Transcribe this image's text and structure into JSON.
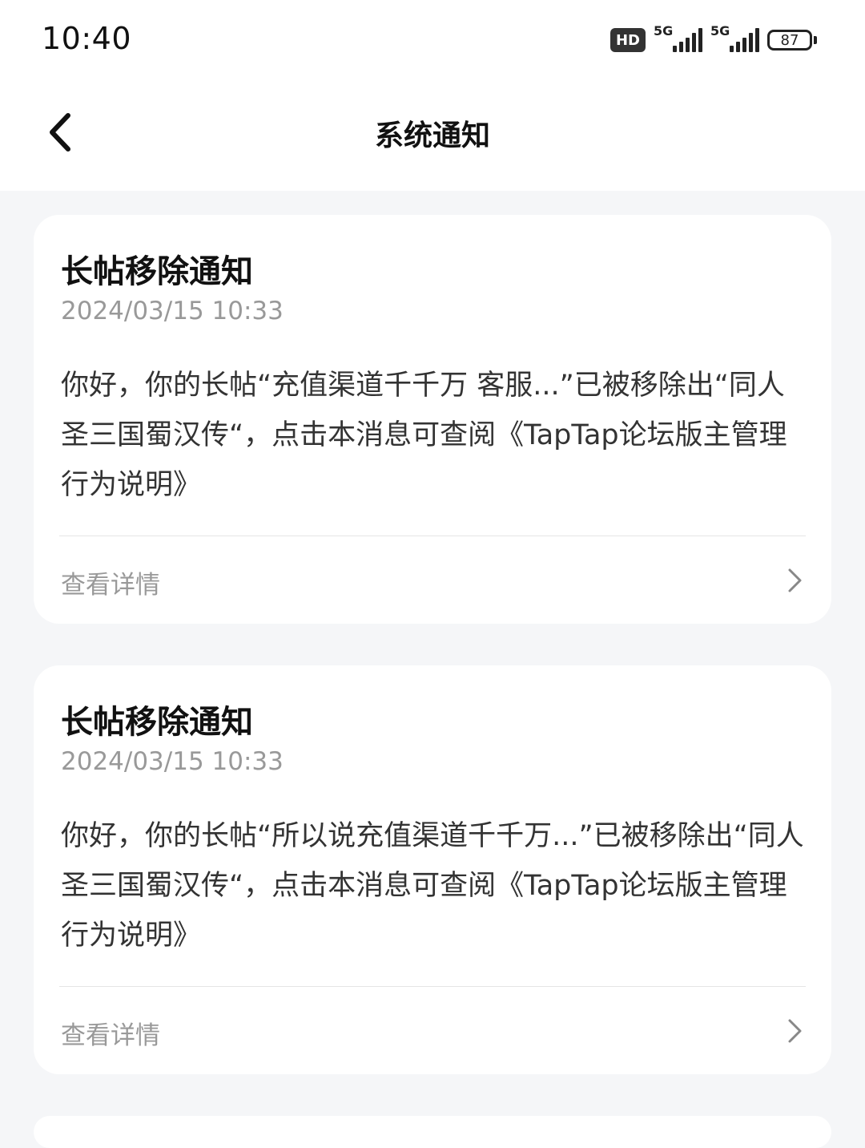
{
  "status_bar": {
    "time": "10:40",
    "hd_label": "HD",
    "network_1": "5G",
    "network_2": "5G",
    "battery": "87"
  },
  "nav": {
    "title": "系统通知"
  },
  "notifications": [
    {
      "title": "长帖移除通知",
      "time": "2024/03/15 10:33",
      "body": "你好，你的长帖“充值渠道千千万 客服...”已被移除出“同人圣三国蜀汉传“，点击本消息可查阅《TapTap论坛版主管理行为说明》",
      "detail_label": "查看详情"
    },
    {
      "title": "长帖移除通知",
      "time": "2024/03/15 10:33",
      "body": "你好，你的长帖“所以说充值渠道千千万...”已被移除出“同人圣三国蜀汉传“，点击本消息可查阅《TapTap论坛版主管理行为说明》",
      "detail_label": "查看详情"
    }
  ]
}
